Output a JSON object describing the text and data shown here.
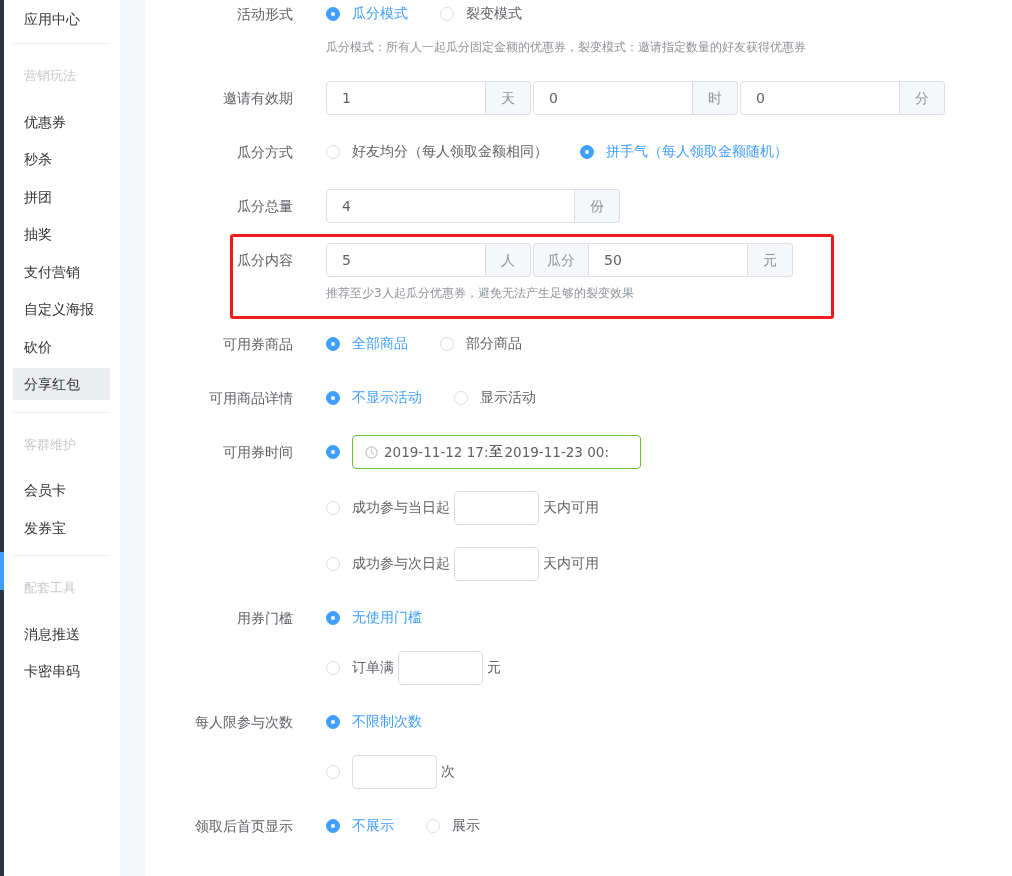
{
  "sidebar": {
    "sections": [
      {
        "items": [
          {
            "label": "应用中心",
            "selected": false
          }
        ]
      },
      {
        "heading": "营销玩法",
        "items": [
          {
            "label": "优惠券",
            "selected": false
          },
          {
            "label": "秒杀",
            "selected": false
          },
          {
            "label": "拼团",
            "selected": false
          },
          {
            "label": "抽奖",
            "selected": false
          },
          {
            "label": "支付营销",
            "selected": false
          },
          {
            "label": "自定义海报",
            "selected": false
          },
          {
            "label": "砍价",
            "selected": false
          },
          {
            "label": "分享红包",
            "selected": true
          }
        ]
      },
      {
        "heading": "客群维护",
        "items": [
          {
            "label": "会员卡",
            "selected": false
          },
          {
            "label": "发券宝",
            "selected": false
          }
        ]
      },
      {
        "heading": "配套工具",
        "items": [
          {
            "label": "消息推送",
            "selected": false
          },
          {
            "label": "卡密串码",
            "selected": false
          }
        ]
      }
    ]
  },
  "form": {
    "rows": [
      {
        "label": "活动形式",
        "kind": "radios",
        "highlighted": false,
        "options": [
          {
            "label": "瓜分模式",
            "selected": true
          },
          {
            "label": "裂变模式",
            "selected": false
          }
        ],
        "hint": "瓜分模式：所有人一起瓜分固定金额的优惠券，裂变模式：邀请指定数量的好友获得优惠券"
      },
      {
        "label": "邀请有效期",
        "kind": "inputs",
        "highlighted": false,
        "groups": [
          {
            "parts": [
              {
                "kind": "input",
                "value": "1"
              },
              {
                "kind": "addon",
                "text": "天"
              }
            ]
          },
          {
            "parts": [
              {
                "kind": "input",
                "value": "0"
              },
              {
                "kind": "addon",
                "text": "时"
              }
            ]
          },
          {
            "parts": [
              {
                "kind": "input",
                "value": "0"
              },
              {
                "kind": "addon",
                "text": "分"
              }
            ]
          }
        ]
      },
      {
        "label": "瓜分方式",
        "kind": "radios",
        "highlighted": false,
        "options": [
          {
            "label": "好友均分（每人领取金额相同）",
            "selected": false
          },
          {
            "label": "拼手气（每人领取金额随机）",
            "selected": true
          }
        ]
      },
      {
        "label": "瓜分总量",
        "kind": "inputs",
        "highlighted": false,
        "groups": [
          {
            "parts": [
              {
                "kind": "input",
                "value": "4"
              },
              {
                "kind": "addon",
                "text": "份"
              }
            ]
          }
        ]
      },
      {
        "label": "瓜分内容",
        "kind": "inputs",
        "highlighted": true,
        "groups": [
          {
            "parts": [
              {
                "kind": "input",
                "value": "5"
              },
              {
                "kind": "addon",
                "text": "人"
              }
            ]
          },
          {
            "parts": [
              {
                "kind": "addon",
                "text": "瓜分"
              },
              {
                "kind": "input",
                "value": "50"
              },
              {
                "kind": "addon",
                "text": "元"
              }
            ]
          }
        ],
        "hint": "推荐至少3人起瓜分优惠券，避免无法产生足够的裂变效果"
      },
      {
        "label": "可用券商品",
        "kind": "radios",
        "highlighted": false,
        "options": [
          {
            "label": "全部商品",
            "selected": true
          },
          {
            "label": "部分商品",
            "selected": false
          }
        ]
      },
      {
        "label": "可用商品详情",
        "kind": "radios",
        "highlighted": false,
        "options": [
          {
            "label": "不显示活动",
            "selected": true
          },
          {
            "label": "显示活动",
            "selected": false
          }
        ]
      },
      {
        "label": "可用券时间",
        "kind": "options",
        "highlighted": false,
        "options": [
          {
            "kind": "date-range",
            "selected": true,
            "start": "2019-11-12 17:",
            "separator": "至",
            "end": "2019-11-23 00:"
          },
          {
            "kind": "input",
            "selected": false,
            "prefix": "成功参与当日起",
            "suffix": "天内可用"
          },
          {
            "kind": "input",
            "selected": false,
            "prefix": "成功参与次日起",
            "suffix": "天内可用"
          }
        ]
      },
      {
        "label": "用券门槛",
        "kind": "options",
        "highlighted": false,
        "options": [
          {
            "kind": "text",
            "selected": true,
            "label": "无使用门槛"
          },
          {
            "kind": "input",
            "selected": false,
            "prefix": "订单满",
            "suffix": "元"
          }
        ]
      },
      {
        "label": "每人限参与次数",
        "kind": "options",
        "highlighted": false,
        "options": [
          {
            "kind": "text",
            "selected": true,
            "label": "不限制次数"
          },
          {
            "kind": "input",
            "selected": false,
            "suffix": "次"
          }
        ]
      },
      {
        "label": "领取后首页显示",
        "kind": "radios",
        "highlighted": false,
        "options": [
          {
            "label": "不展示",
            "selected": true
          },
          {
            "label": "展示",
            "selected": false
          }
        ]
      }
    ]
  }
}
